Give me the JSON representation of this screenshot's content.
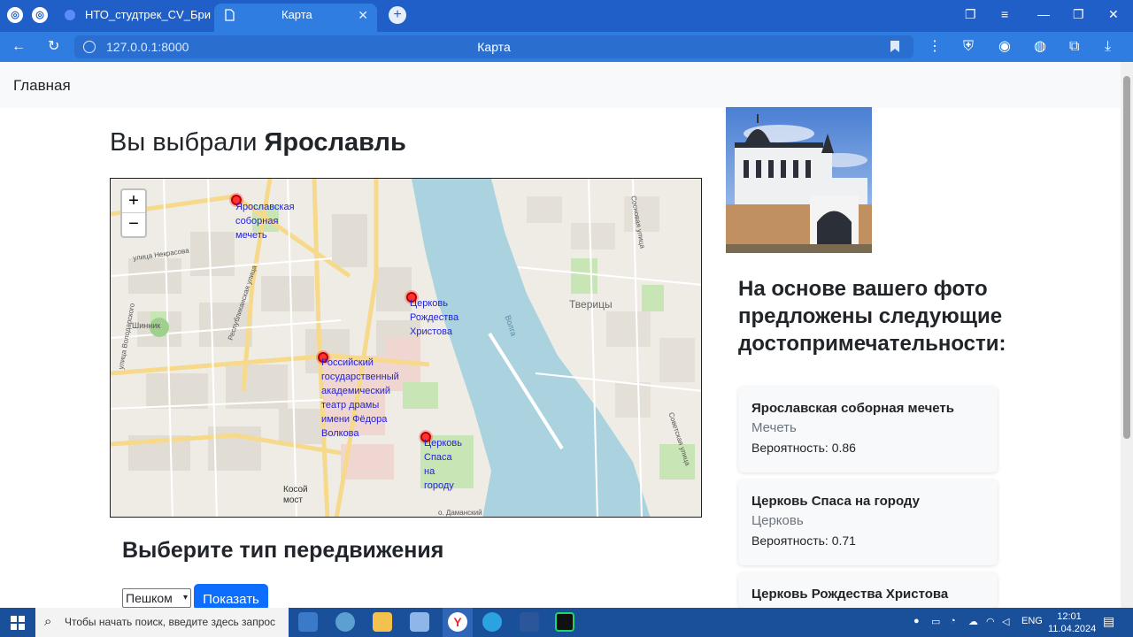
{
  "browser": {
    "tabs": [
      {
        "label": "НТО_студтрек_CV_Бриф_ф",
        "active": false
      },
      {
        "label": "Карта",
        "active": true
      }
    ],
    "url": "127.0.0.1:8000",
    "page_title": "Карта",
    "new_tab": "+"
  },
  "navbar": {
    "brand": "Главная"
  },
  "heading": {
    "prefix": "Вы выбрали ",
    "city": "Ярославль"
  },
  "map": {
    "zoom_in": "+",
    "zoom_out": "−",
    "markers": [
      {
        "label": "Ярославская соборная мечеть"
      },
      {
        "label": "Церковь Рождества Христова"
      },
      {
        "label": "Российский государственный академический театр драмы имени Фёдора Волкова"
      },
      {
        "label": "Церковь Спаса на городу"
      }
    ],
    "place_labels": {
      "tveritsy": "Тверицы",
      "volga": "Волга",
      "nekrasova": "улица Некрасова",
      "shinnik": "Шинник",
      "kosoy_most": "Косой мост",
      "respublikanskaya": "Республиканская улица",
      "sovetskaya": "Советская улица",
      "sosnovaya": "Сосновая улица",
      "volodarskogo": "улица Володарского",
      "damanskiy": "о. Даманский"
    }
  },
  "transport": {
    "title": "Выберите тип передвижения",
    "selected": "Пешком",
    "button": "Показать"
  },
  "recommendations": {
    "title": "На основе вашего фото предложены следующие достопримечательности:",
    "items": [
      {
        "name": "Ярославская соборная мечеть",
        "type": "Мечеть",
        "probability": "Вероятность: 0.86"
      },
      {
        "name": "Церковь Спаса на городу",
        "type": "Церковь",
        "probability": "Вероятность: 0.71"
      },
      {
        "name": "Церковь Рождества Христова",
        "type": "",
        "probability": ""
      }
    ]
  },
  "taskbar": {
    "search_placeholder": "Чтобы начать поиск, введите здесь запрос",
    "language": "ENG",
    "time": "12:01",
    "date": "11.04.2024"
  }
}
